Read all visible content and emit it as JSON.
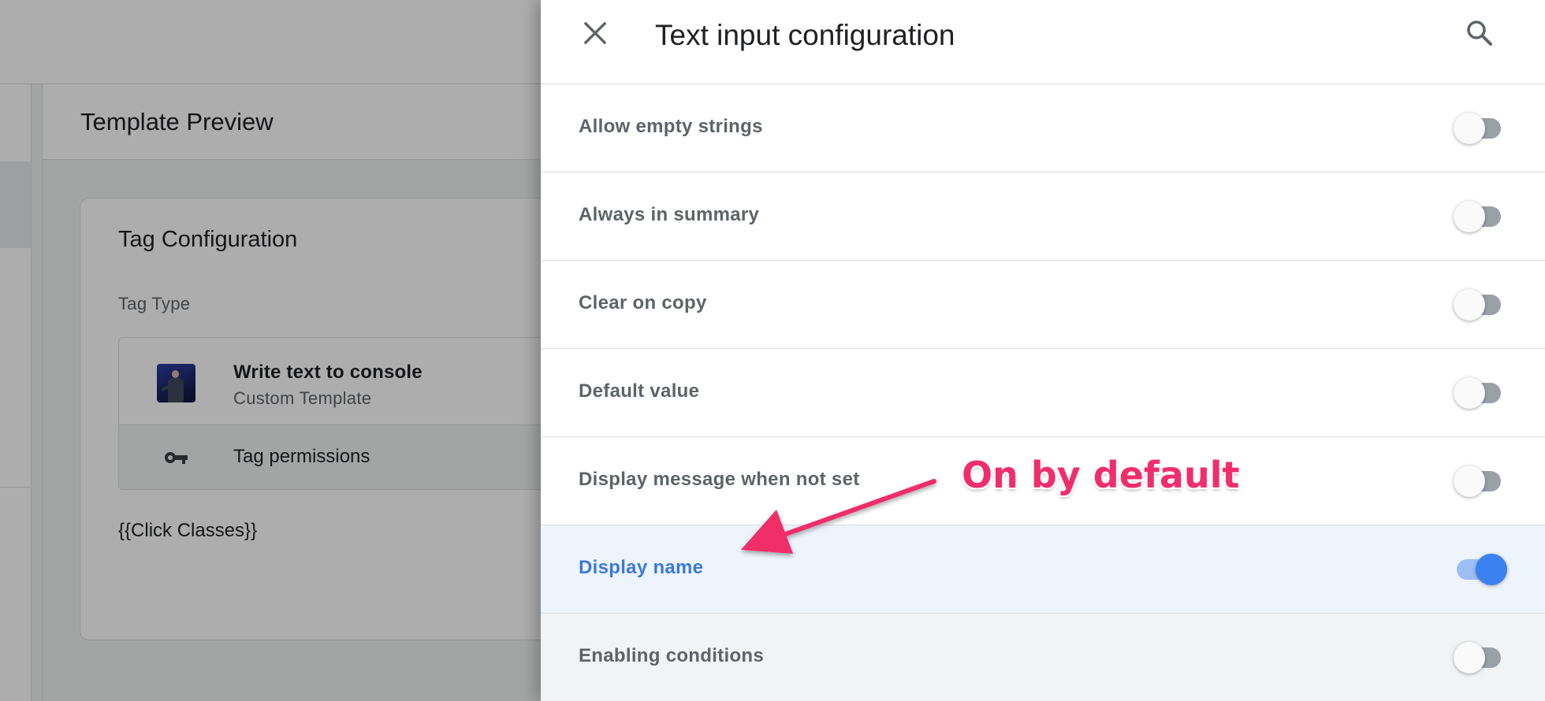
{
  "background": {
    "header_title": "Template Preview",
    "card": {
      "title": "Tag Configuration",
      "tag_type_label": "Tag Type",
      "tag_name": "Write text to console",
      "tag_subtitle": "Custom Template",
      "permissions_label": "Tag permissions",
      "variable": "{{Click Classes}}"
    }
  },
  "panel": {
    "title": "Text input configuration",
    "close_icon": "close-icon",
    "search_icon": "search-icon",
    "settings": [
      {
        "label": "Allow empty strings",
        "enabled": false
      },
      {
        "label": "Always in summary",
        "enabled": false
      },
      {
        "label": "Clear on copy",
        "enabled": false
      },
      {
        "label": "Default value",
        "enabled": false
      },
      {
        "label": "Display message when not set",
        "enabled": false
      },
      {
        "label": "Display name",
        "enabled": true
      },
      {
        "label": "Enabling conditions",
        "enabled": false
      }
    ]
  },
  "annotation": {
    "text": "On by default",
    "color": "#ef2e6b"
  },
  "colors": {
    "accent": "#3b82f0",
    "active_label": "#3b79dd",
    "active_row": "#eef4fc"
  }
}
